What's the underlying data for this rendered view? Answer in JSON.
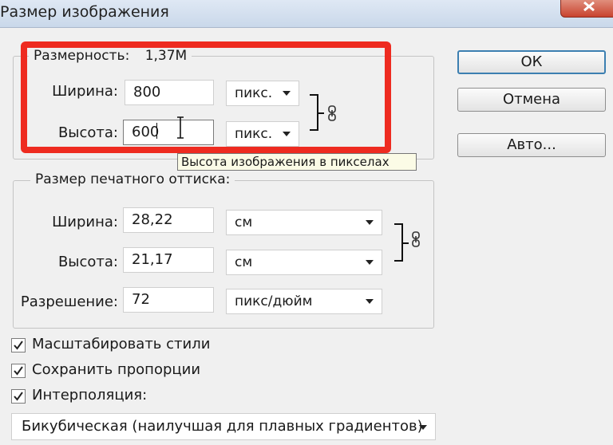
{
  "window": {
    "title": "Размер изображения"
  },
  "pixel_dimensions": {
    "legend_label": "Размерность:",
    "size_value": "1,37M",
    "width": {
      "label": "Ширина:",
      "value": "800",
      "unit": "пикс."
    },
    "height": {
      "label": "Высота:",
      "value": "600",
      "unit": "пикс."
    },
    "tooltip": "Высота изображения в пикселах"
  },
  "document_size": {
    "legend": "Размер печатного оттиска:",
    "width": {
      "label": "Ширина:",
      "value": "28,22",
      "unit": "см"
    },
    "height": {
      "label": "Высота:",
      "value": "21,17",
      "unit": "см"
    },
    "resolution": {
      "label": "Разрешение:",
      "value": "72",
      "unit": "пикс/дюйм"
    }
  },
  "buttons": {
    "ok": "ОК",
    "cancel": "Отмена",
    "auto": "Авто..."
  },
  "options": {
    "scale_styles": {
      "label": "Масштабировать стили",
      "checked": true
    },
    "constrain": {
      "label": "Сохранить пропорции",
      "checked": true
    },
    "resample": {
      "label": "Интерполяция:",
      "checked": true
    },
    "method": "Бикубическая (наилучшая для плавных градиентов)"
  },
  "colors": {
    "highlight": "#ee2b20",
    "default_button_border": "#3c7fb1"
  },
  "icons": {
    "link": "chain-link-icon",
    "check": "checkmark-icon",
    "close": "close-icon"
  }
}
